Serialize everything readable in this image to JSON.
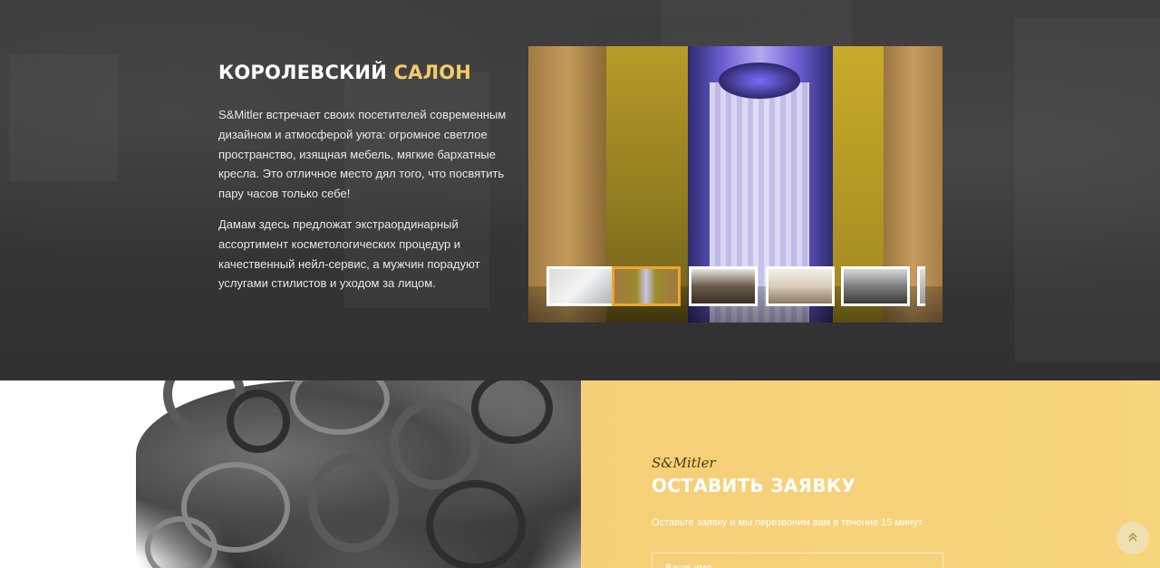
{
  "salon": {
    "title_main": "КОРОЛЕВСКИЙ",
    "title_accent": "САЛОН",
    "paragraph_1": "S&Mitler встречает своих посетителей современным дизайном и атмосферой уюта: огромное светлое пространство, изящная мебель, мягкие бархатные кресла. Это отличное место дял того, что посвятить пару часов только себе!",
    "paragraph_2": "Дамам здесь предложат экстраординарный ассортимент косметологических процедур и качественный нейл-сервис, а мужчин порадуют услугами стилистов и уходом за лицом.",
    "accent_color": "#f5cc69"
  },
  "gallery": {
    "active_thumbnail": 2,
    "thumbnail_count": 6,
    "active_border_color": "#f0a72a"
  },
  "request": {
    "brand": "S&Mitler",
    "title": "ОСТАВИТЬ ЗАЯВКУ",
    "subtitle": "Оставьте заявку и мы перезвоним вам в течение 15 минут",
    "name_placeholder": "Ваше имя",
    "background_color": "#f7d57c"
  },
  "scroll_top": {
    "icon": "double-chevron-up-icon"
  }
}
